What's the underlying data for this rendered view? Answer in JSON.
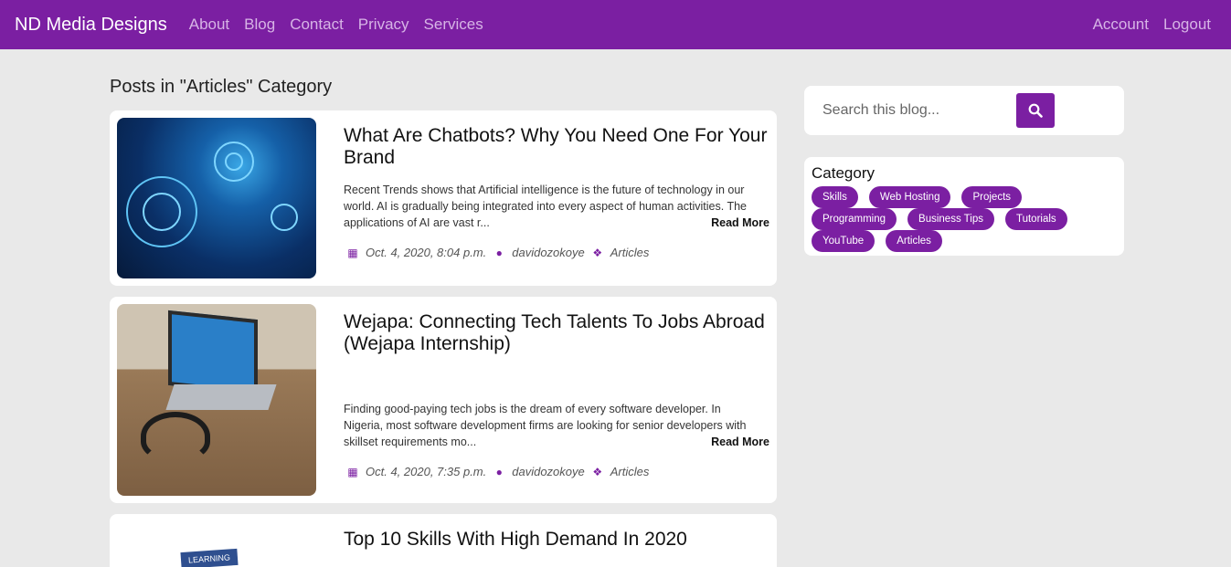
{
  "nav": {
    "brand": "ND Media Designs",
    "links": [
      "About",
      "Blog",
      "Contact",
      "Privacy",
      "Services"
    ],
    "right": [
      "Account",
      "Logout"
    ]
  },
  "page": {
    "title": "Posts in \"Articles\" Category"
  },
  "posts": [
    {
      "title": "What Are Chatbots? Why You Need One For Your Brand",
      "excerpt": "Recent Trends shows that Artificial intelligence is the future of technology in our world. AI is gradually being integrated into every aspect of human activities. The applications of AI are vast r...",
      "read_more": "Read More",
      "date": "Oct. 4, 2020, 8:04 p.m.",
      "author": "davidozokoye",
      "category": "Articles"
    },
    {
      "title": "Wejapa: Connecting Tech Talents To Jobs Abroad (Wejapa Internship)",
      "excerpt": "Finding good-paying tech jobs is the dream of every software developer. In Nigeria, most software development firms are looking for senior developers with skillset requirements mo...",
      "read_more": "Read More",
      "date": "Oct. 4, 2020, 7:35 p.m.",
      "author": "davidozokoye",
      "category": "Articles"
    },
    {
      "title": "Top 10 Skills With High Demand In 2020",
      "thumb_text": "LEARNING"
    }
  ],
  "sidebar": {
    "search_placeholder": "Search this blog...",
    "category_title": "Category",
    "tags": [
      "Skills",
      "Web Hosting",
      "Projects",
      "Programming",
      "Business Tips",
      "Tutorials",
      "YouTube",
      "Articles"
    ]
  },
  "colors": {
    "brand": "#7b1fa2",
    "background": "#e9e9e9"
  }
}
